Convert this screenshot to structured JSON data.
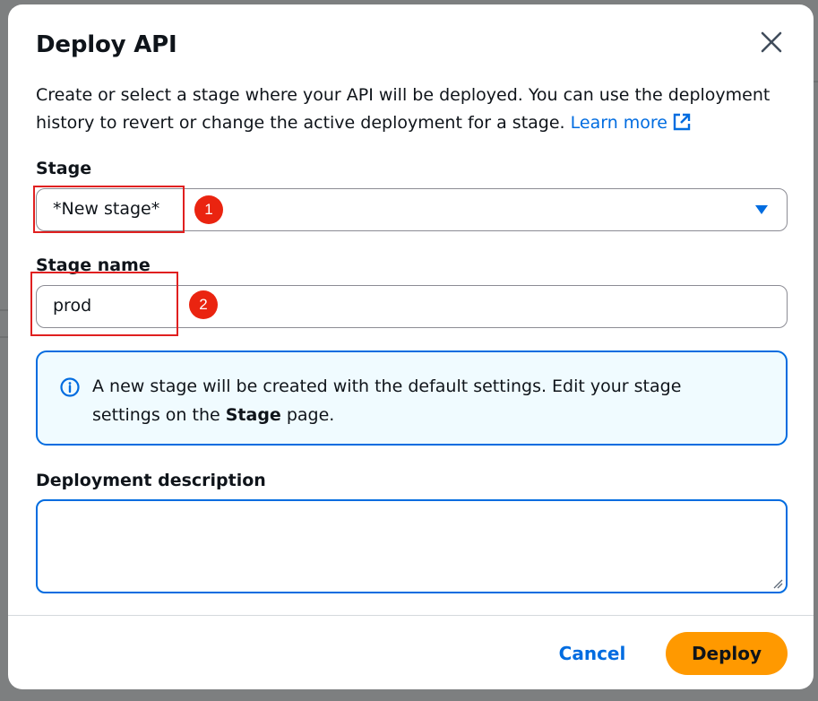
{
  "dialog": {
    "title": "Deploy API",
    "description": "Create or select a stage where your API will be deployed. You can use the deployment history to revert or change the active deployment for a stage.",
    "learn_more_label": "Learn more",
    "close_icon": "close-icon"
  },
  "stage": {
    "label": "Stage",
    "selected_value": "*New stage*"
  },
  "stage_name": {
    "label": "Stage name",
    "value": "prod"
  },
  "info_alert": {
    "text_before": "A new stage will be created with the default settings. Edit your stage settings on the ",
    "text_bold": "Stage",
    "text_after": " page."
  },
  "deployment_description": {
    "label": "Deployment description",
    "value": ""
  },
  "footer": {
    "cancel_label": "Cancel",
    "deploy_label": "Deploy"
  },
  "annotations": [
    {
      "number": "1"
    },
    {
      "number": "2"
    }
  ],
  "colors": {
    "accent": "#006ce0",
    "primary_button": "#ff9900",
    "info_background": "#f0fbff",
    "annotation": "#ea2410"
  }
}
